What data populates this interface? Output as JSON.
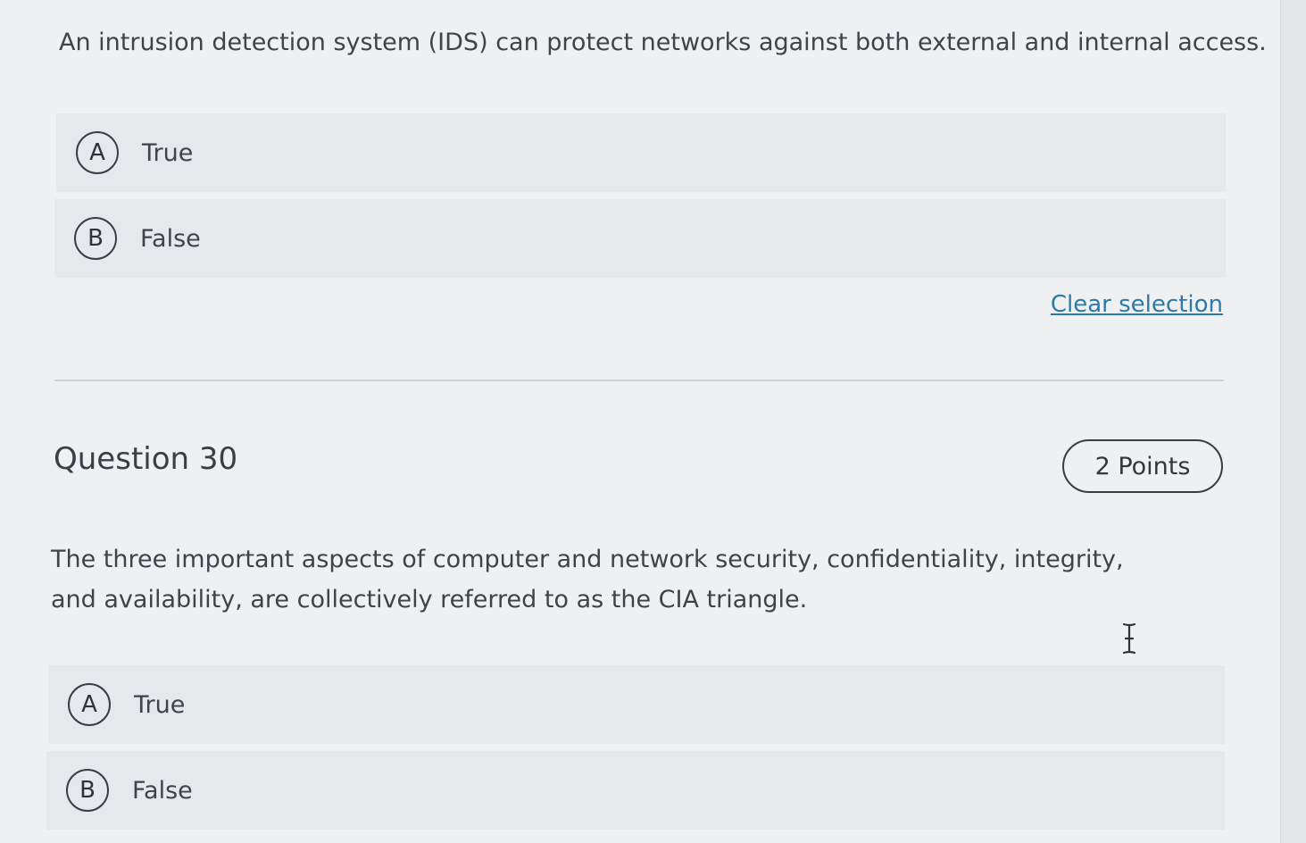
{
  "previous_question": {
    "text": "An intrusion detection system (IDS) can protect networks against both external and internal access.",
    "options": [
      {
        "letter": "A",
        "label": "True"
      },
      {
        "letter": "B",
        "label": "False"
      }
    ],
    "clear_selection_label": "Clear selection"
  },
  "question": {
    "title": "Question 30",
    "points": "2 Points",
    "text": "The three important aspects of computer and network security, confidentiality, integrity, and availability, are collectively referred to as the CIA triangle.",
    "options": [
      {
        "letter": "A",
        "label": "True"
      },
      {
        "letter": "B",
        "label": "False"
      }
    ]
  },
  "colors": {
    "link": "#2c7aa8",
    "option_background": "#e6e8eb"
  },
  "icons": {
    "cursor": "text-cursor-icon"
  }
}
